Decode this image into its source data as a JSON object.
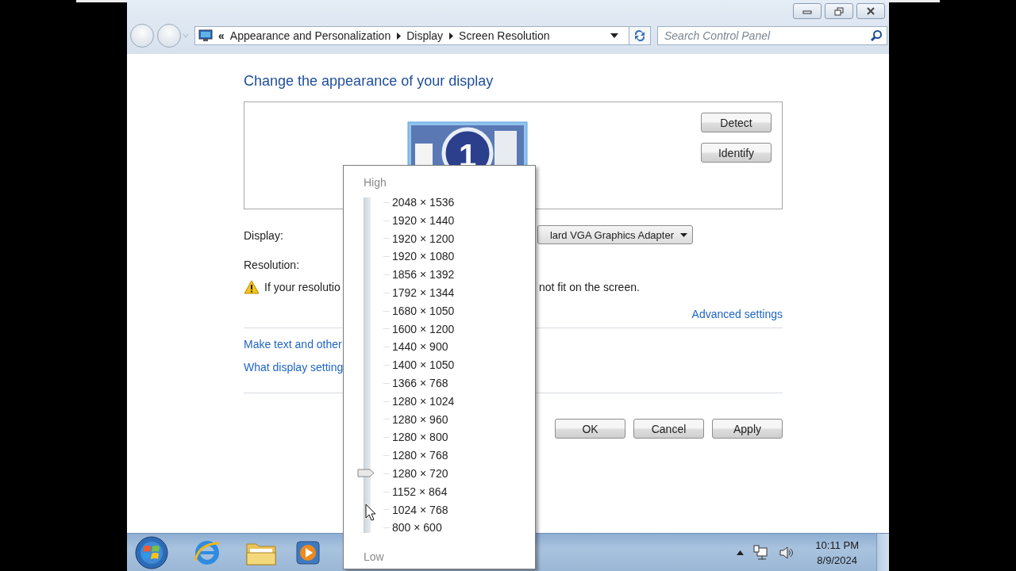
{
  "address_bar": {
    "overflow": "«",
    "crumbs": [
      "Appearance and Personalization",
      "Display",
      "Screen Resolution"
    ]
  },
  "search": {
    "placeholder": "Search Control Panel"
  },
  "heading": "Change the appearance of your display",
  "monitor": {
    "label": "1"
  },
  "side_buttons": [
    "Detect",
    "Identify"
  ],
  "display": {
    "label": "Display:",
    "value": "lard VGA Graphics Adapter"
  },
  "resolution": {
    "label": "Resolution:"
  },
  "warning": {
    "parts": [
      "If your resolutio",
      "not fit on the screen."
    ]
  },
  "advanced_link": "Advanced settings",
  "links": [
    "Make text and other",
    "What display setting"
  ],
  "dialog_buttons": [
    "OK",
    "Cancel",
    "Apply"
  ],
  "resolution_popup": {
    "high": "High",
    "low": "Low",
    "level": 0.168,
    "options": [
      "2048 × 1536",
      "1920 × 1440",
      "1920 × 1200",
      "1920 × 1080",
      "1856 × 1392",
      "1792 × 1344",
      "1680 × 1050",
      "1600 × 1200",
      "1440 × 900",
      "1400 × 1050",
      "1366 × 768",
      "1280 × 1024",
      "1280 × 960",
      "1280 × 800",
      "1280 × 768",
      "1280 × 720",
      "1152 × 864",
      "1024 × 768",
      "800 × 600"
    ]
  },
  "taskbar": {
    "time": "10:11 PM",
    "date": "8/9/2024"
  }
}
